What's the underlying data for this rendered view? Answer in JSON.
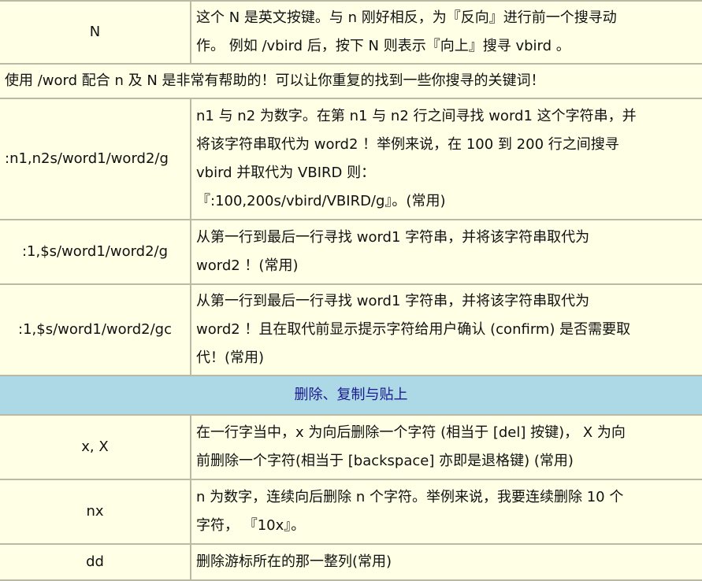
{
  "rows": [
    {
      "command": "N",
      "description": [
        "这个 N 是英文按键。与 n 刚好相反，为『反向』进行前一个搜寻动",
        "作。 例如 /vbird 后，按下 N 则表示『向上』搜寻 vbird 。"
      ]
    },
    {
      "note": "使用 /word 配合 n 及 N 是非常有帮助的！可以让你重复的找到一些你搜寻的关键词！"
    },
    {
      "command": ":n1,n2s/word1/word2/g",
      "description": [
        "n1 与 n2 为数字。在第 n1 与 n2 行之间寻找 word1 这个字符串，并",
        "将该字符串取代为 word2 ！举例来说，在 100 到 200 行之间搜寻",
        "vbird 并取代为 VBIRD 则：",
        "『:100,200s/vbird/VBIRD/g』。(常用)"
      ]
    },
    {
      "command": ":1,$s/word1/word2/g",
      "description": [
        "从第一行到最后一行寻找 word1 字符串，并将该字符串取代为",
        "word2 ！(常用)"
      ]
    },
    {
      "command": ":1,$s/word1/word2/gc",
      "description": [
        "从第一行到最后一行寻找 word1 字符串，并将该字符串取代为",
        "word2 ！且在取代前显示提示字符给用户确认 (confirm) 是否需要取",
        "代！(常用)"
      ]
    },
    {
      "section": "删除、复制与贴上"
    },
    {
      "command": "x, X",
      "description": [
        "在一行字当中，x 为向后删除一个字符 (相当于 [del] 按键)， X 为向",
        "前删除一个字符(相当于 [backspace] 亦即是退格键) (常用)"
      ]
    },
    {
      "command": "nx",
      "description": [
        "n 为数字，连续向后删除 n 个字符。举例来说，我要连续删除 10 个",
        "字符， 『10x』。"
      ]
    },
    {
      "command": "dd",
      "description": [
        "删除游标所在的那一整列(常用)"
      ]
    }
  ],
  "colors": {
    "cell_background": "#ffffe6",
    "cell_border": "#b9b9a4",
    "section_background": "#add8e6",
    "section_text": "#1a1a8c"
  }
}
